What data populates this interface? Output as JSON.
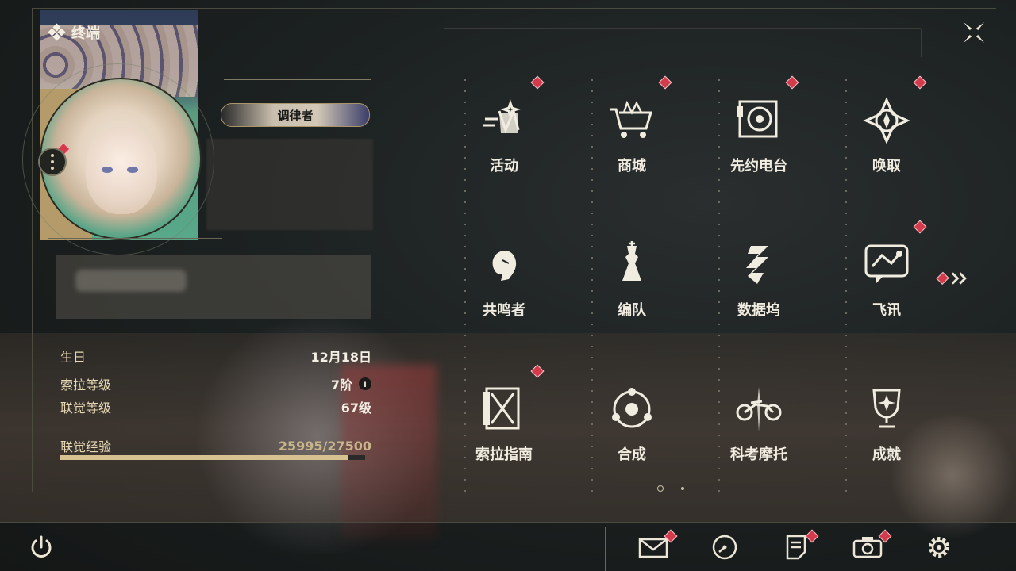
{
  "header": {
    "title": "终端"
  },
  "profile": {
    "tag_label": "调律者"
  },
  "stats": {
    "birthday_label": "生日",
    "birthday_value": "12月18日",
    "sola_level_label": "索拉等级",
    "sola_level_value": "7阶",
    "union_level_label": "联觉等级",
    "union_level_value": "67级",
    "union_exp_label": "联觉经验",
    "union_exp_value": "25995/27500",
    "union_exp_progress": 0.945
  },
  "menu": {
    "items": [
      {
        "label": "活动",
        "icon": "events-icon",
        "badge": true
      },
      {
        "label": "商城",
        "icon": "shop-cart-icon",
        "badge": true
      },
      {
        "label": "先约电台",
        "icon": "radio-icon",
        "badge": true
      },
      {
        "label": "唤取",
        "icon": "convene-icon",
        "badge": true
      },
      {
        "label": "共鸣者",
        "icon": "resonator-icon",
        "badge": false
      },
      {
        "label": "编队",
        "icon": "team-icon",
        "badge": false
      },
      {
        "label": "数据坞",
        "icon": "data-bank-icon",
        "badge": false
      },
      {
        "label": "飞讯",
        "icon": "message-icon",
        "badge": true
      },
      {
        "label": "索拉指南",
        "icon": "guide-icon",
        "badge": true
      },
      {
        "label": "合成",
        "icon": "synthesis-icon",
        "badge": false
      },
      {
        "label": "科考摩托",
        "icon": "motorcycle-icon",
        "badge": false
      },
      {
        "label": "成就",
        "icon": "trophy-icon",
        "badge": false
      }
    ]
  },
  "colors": {
    "accent": "#d8c190",
    "badge": "#d33b4c",
    "text": "#f1ece0"
  }
}
